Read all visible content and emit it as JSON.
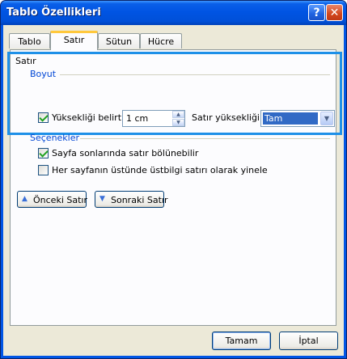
{
  "window": {
    "title": "Tablo Özellikleri"
  },
  "titlebar_buttons": {
    "help": "?",
    "close": "✕"
  },
  "tabs": [
    {
      "label": "Tablo"
    },
    {
      "label": "Satır",
      "active": true
    },
    {
      "label": "Sütun"
    },
    {
      "label": "Hücre"
    }
  ],
  "satir_label": "Satır",
  "boyut": {
    "title": "Boyut",
    "specify_height_label": "Yüksekliği belirt:",
    "specify_height_checked": true,
    "height_value": "1 cm",
    "row_height_label": "Satır yüksekliği:",
    "row_height_value": "Tam"
  },
  "secenekler": {
    "title": "Seçenekler",
    "allow_break_label": "Sayfa sonlarında satır bölünebilir",
    "allow_break_checked": true,
    "repeat_header_label": "Her sayfanın üstünde üstbilgi satırı olarak yinele",
    "repeat_header_checked": false
  },
  "nav": {
    "prev_label": "Önceki Satır",
    "next_label": "Sonraki Satır"
  },
  "buttons": {
    "ok": "Tamam",
    "cancel": "İptal"
  },
  "colors": {
    "title_bar": "#0054e3",
    "group_label": "#0046d5",
    "highlight": "#1e90e8",
    "selection": "#316ac5"
  }
}
